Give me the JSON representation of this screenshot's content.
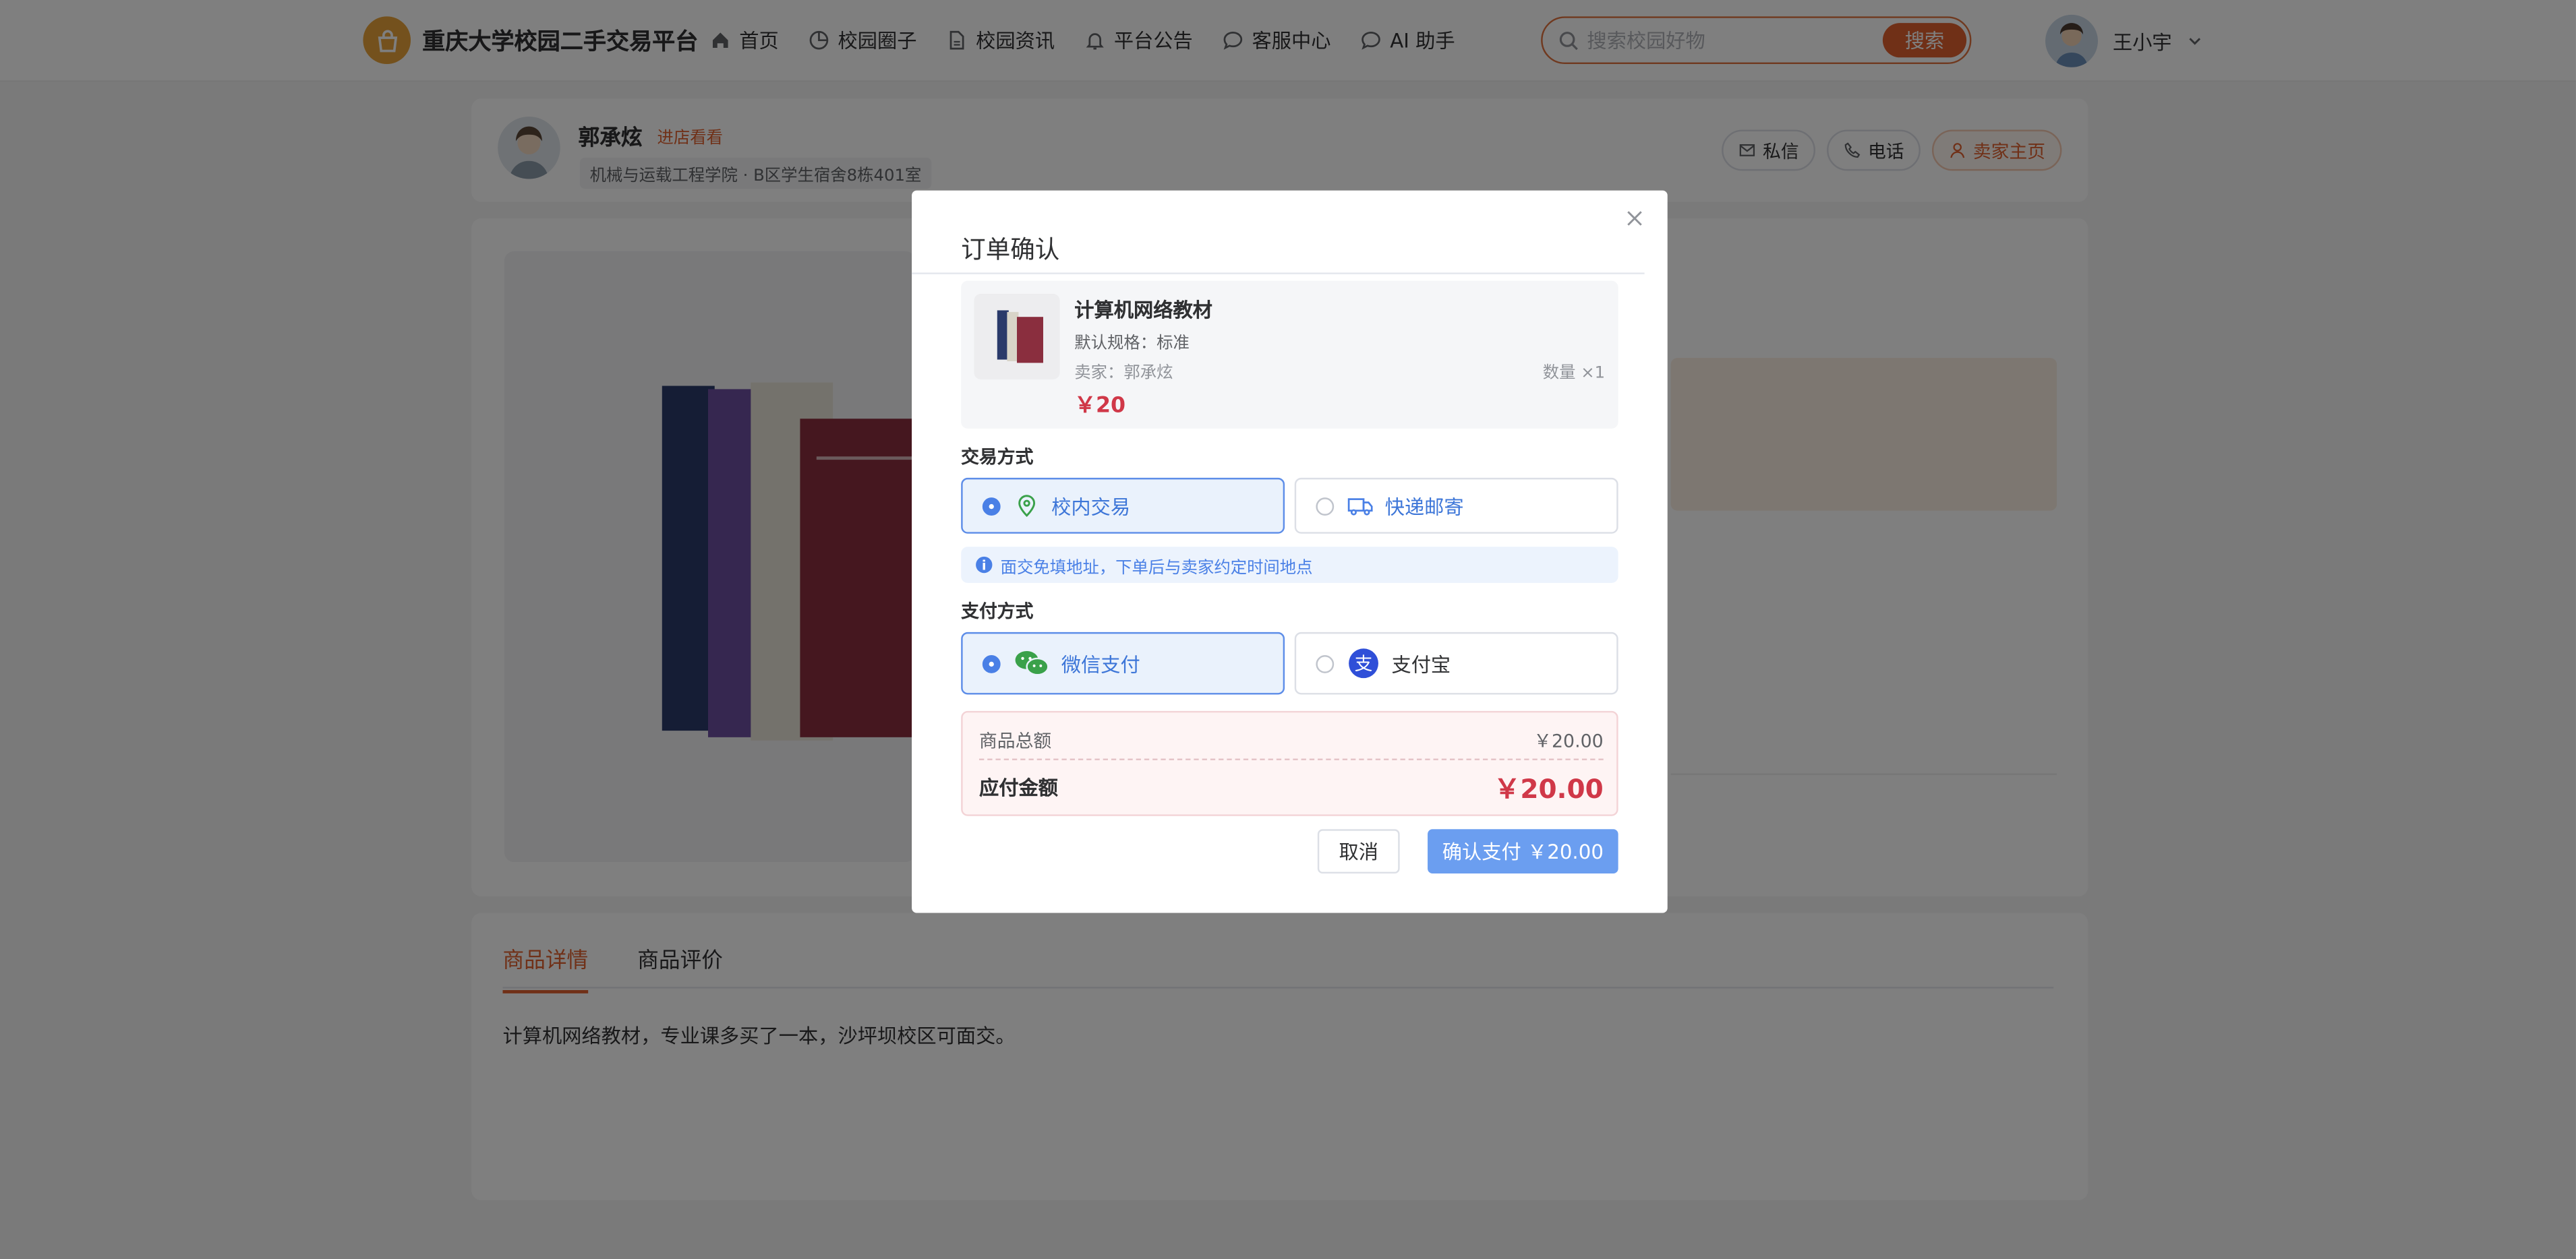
{
  "header": {
    "site_title": "重庆大学校园二手交易平台",
    "nav": [
      {
        "label": "首页",
        "icon": "home-icon"
      },
      {
        "label": "校园圈子",
        "icon": "pie-chart-icon"
      },
      {
        "label": "校园资讯",
        "icon": "document-icon"
      },
      {
        "label": "平台公告",
        "icon": "bell-icon"
      },
      {
        "label": "客服中心",
        "icon": "chat-bubble-icon"
      },
      {
        "label": "AI 助手",
        "icon": "chat-bubble-icon"
      }
    ],
    "search_placeholder": "搜索校园好物",
    "search_button": "搜索",
    "user_name": "王小宇"
  },
  "seller": {
    "name": "郭承炫",
    "shop_link": "进店看看",
    "info": "机械与运载工程学院 · B区学生宿舍8栋401室",
    "actions": {
      "message": "私信",
      "phone": "电话",
      "homepage": "卖家主页"
    }
  },
  "detail": {
    "tabs": [
      "商品详情",
      "商品评价"
    ],
    "description": "计算机网络教材，专业课多买了一本，沙坪坝校区可面交。"
  },
  "modal": {
    "title": "订单确认",
    "item": {
      "name": "计算机网络教材",
      "spec": "默认规格：标准",
      "seller": "卖家：郭承炫",
      "quantity": "数量 ×1",
      "price": "￥20"
    },
    "trade_label": "交易方式",
    "trade_options": [
      {
        "label": "校内交易",
        "selected": true
      },
      {
        "label": "快递邮寄",
        "selected": false
      }
    ],
    "trade_tip": "面交免填地址，下单后与卖家约定时间地点",
    "pay_label": "支付方式",
    "pay_options": [
      {
        "label": "微信支付",
        "selected": true
      },
      {
        "label": "支付宝",
        "selected": false
      }
    ],
    "summary": {
      "subtotal_label": "商品总额",
      "subtotal_value": "￥20.00",
      "total_label": "应付金额",
      "total_value": "￥20.00"
    },
    "cancel_button": "取消",
    "confirm_button": "确认支付 ￥20.00"
  },
  "colors": {
    "accent": "#e0612f",
    "primary": "#5d8de8",
    "price": "#d03848"
  }
}
